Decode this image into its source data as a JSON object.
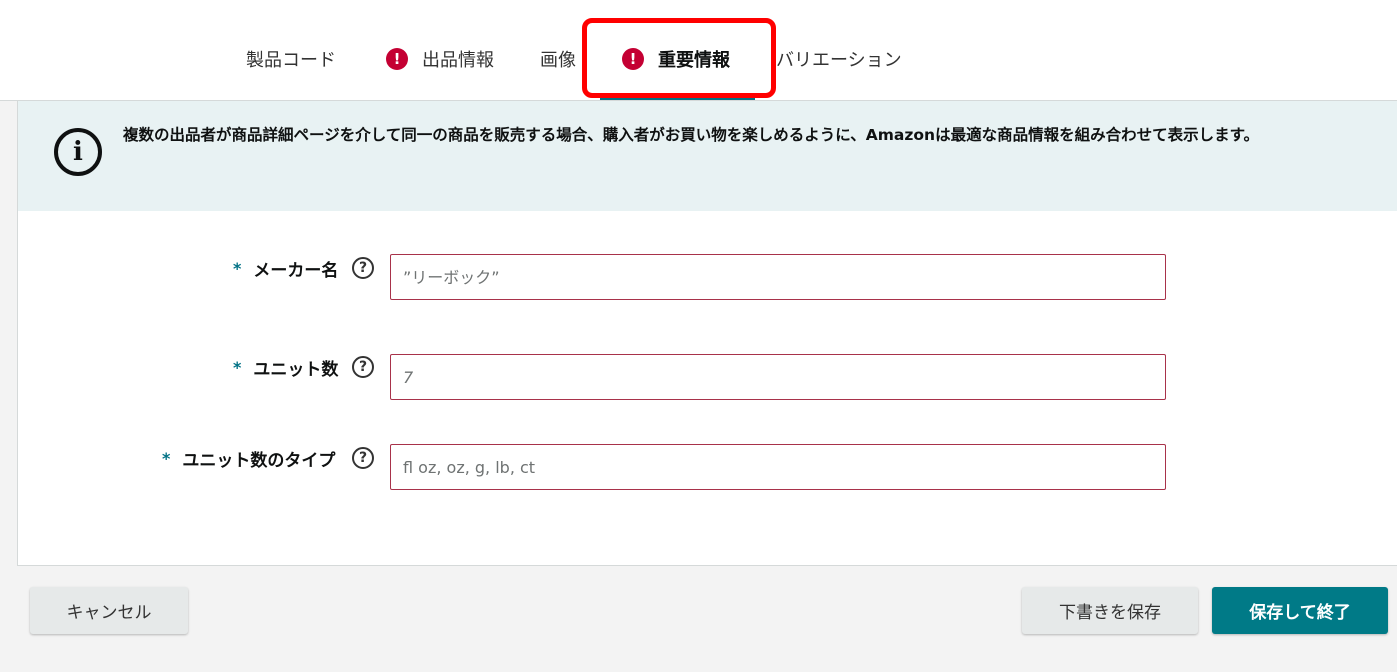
{
  "tabs": [
    {
      "label": "製品コード",
      "error": false
    },
    {
      "label": "出品情報",
      "error": true
    },
    {
      "label": "画像",
      "error": false
    },
    {
      "label": "重要情報",
      "error": true,
      "active": true
    },
    {
      "label": "バリエーション",
      "error": false
    }
  ],
  "error_glyph": "!",
  "info": {
    "icon": "i",
    "text": "複数の出品者が商品詳細ページを介して同一の商品を販売する場合、購入者がお買い物を楽しめるように、Amazonは最適な商品情報を組み合わせて表示します。"
  },
  "form": {
    "required_mark": "*",
    "help_glyph": "?",
    "fields": [
      {
        "label": "メーカー名",
        "placeholder": "”リーボック”",
        "value": ""
      },
      {
        "label": "ユニット数",
        "placeholder": "7",
        "value": ""
      },
      {
        "label": "ユニット数のタイプ",
        "placeholder": "fl oz, oz, g, lb, ct",
        "value": ""
      }
    ]
  },
  "footer": {
    "cancel_label": "キャンセル",
    "save_draft_label": "下書きを保存",
    "save_finish_label": "保存して終了"
  },
  "colors": {
    "accent": "#007185",
    "primary_button": "#007a87",
    "error": "#c40033",
    "input_border": "#a8324a",
    "info_bg": "#e8f2f3",
    "highlight": "#ff0000"
  }
}
